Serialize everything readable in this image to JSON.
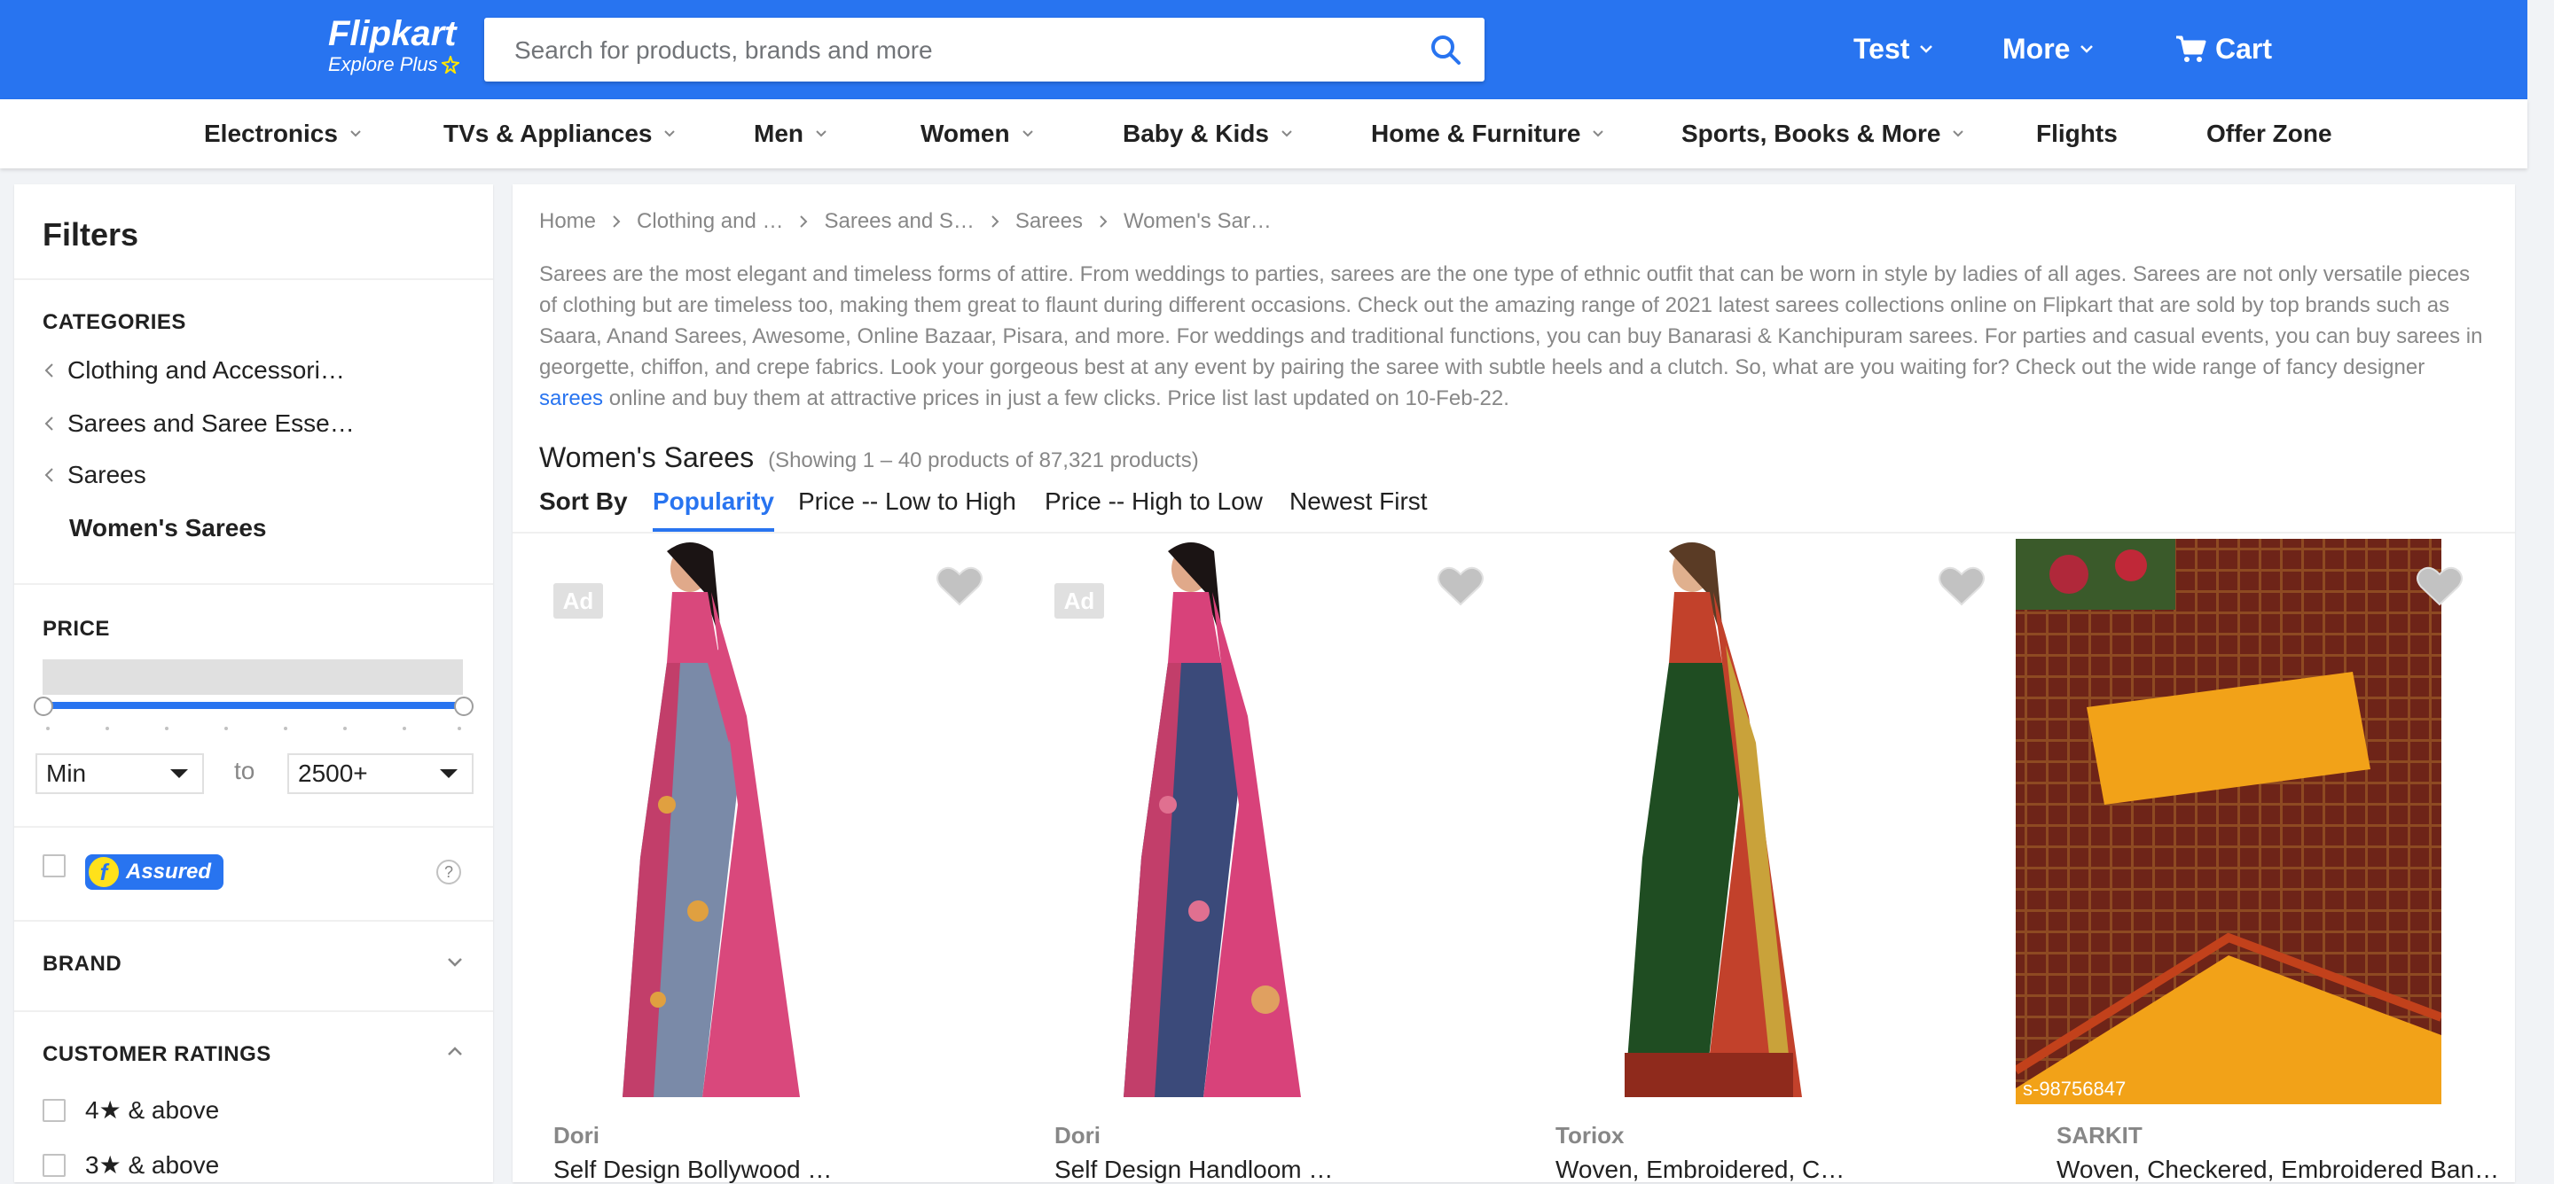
{
  "header": {
    "logo_text": "Flipkart",
    "logo_sub": "Explore Plus",
    "search_placeholder": "Search for products, brands and more",
    "account_label": "Test",
    "more_label": "More",
    "cart_label": "Cart",
    "colors": {
      "bar": "#2874f0",
      "plus": "#ffe500"
    }
  },
  "category_nav": [
    {
      "label": "Electronics",
      "has_dropdown": true
    },
    {
      "label": "TVs & Appliances",
      "has_dropdown": true
    },
    {
      "label": "Men",
      "has_dropdown": true
    },
    {
      "label": "Women",
      "has_dropdown": true
    },
    {
      "label": "Baby & Kids",
      "has_dropdown": true
    },
    {
      "label": "Home & Furniture",
      "has_dropdown": true
    },
    {
      "label": "Sports, Books & More",
      "has_dropdown": true
    },
    {
      "label": "Flights",
      "has_dropdown": false
    },
    {
      "label": "Offer Zone",
      "has_dropdown": false
    }
  ],
  "filters": {
    "title": "Filters",
    "categories_heading": "CATEGORIES",
    "category_path": [
      "Clothing and Accessori…",
      "Sarees and Saree Esse…",
      "Sarees"
    ],
    "current_category": "Women's Sarees",
    "price_heading": "PRICE",
    "price_min": "Min",
    "price_to": "to",
    "price_max": "2500+",
    "assured_label": "Assured",
    "assured_help": "?",
    "brand_heading": "BRAND",
    "ratings_heading": "CUSTOMER RATINGS",
    "ratings": [
      "4★ & above",
      "3★ & above"
    ]
  },
  "breadcrumb": [
    "Home",
    "Clothing and …",
    "Sarees and S…",
    "Sarees",
    "Women's Sar…"
  ],
  "description": {
    "text_before_link": "Sarees are the most elegant and timeless forms of attire. From weddings to parties, sarees are the one type of ethnic outfit that can be worn in style by ladies of all ages. Sarees are not only versatile pieces of clothing but are timeless too, making them great to flaunt during different occasions. Check out the amazing range of 2021 latest sarees collections online on Flipkart that are sold by top brands such as Saara, Anand Sarees, Awesome, Online Bazaar, Pisara, and more. For weddings and traditional functions, you can buy Banarasi & Kanchipuram sarees. For parties and casual events, you can buy sarees in georgette, chiffon, and crepe fabrics. Look your gorgeous best at any event by pairing the saree with subtle heels and a clutch. So, what are you waiting for? Check out the wide range of fancy designer",
    "link_text": "sarees",
    "text_after_link": "online and buy them at attractive prices in just a few clicks. Price list last updated on 10-Feb-22."
  },
  "listing": {
    "title": "Women's Sarees",
    "count": "(Showing 1 – 40 products of 87,321 products)"
  },
  "sort": {
    "label": "Sort By",
    "options": [
      "Popularity",
      "Price -- Low to High",
      "Price -- High to Low",
      "Newest First"
    ],
    "active": "Popularity"
  },
  "products": [
    {
      "brand": "Dori",
      "name": "Self Design Bollywood …",
      "ad": "Ad",
      "palette": [
        "#d9487c",
        "#7a8aa8"
      ]
    },
    {
      "brand": "Dori",
      "name": "Self Design Handloom …",
      "ad": "Ad",
      "palette": [
        "#d8427a",
        "#3b4a7a"
      ]
    },
    {
      "brand": "Toriox",
      "name": "Woven, Embroidered, C…",
      "ad": "",
      "palette": [
        "#1f4d22",
        "#c2412b"
      ]
    },
    {
      "brand": "SARKIT",
      "name": "Woven, Checkered, Embroidered Ban…",
      "ad": "",
      "watermark": "s-98756847",
      "palette": [
        "#6e2418",
        "#f2a218"
      ]
    }
  ]
}
